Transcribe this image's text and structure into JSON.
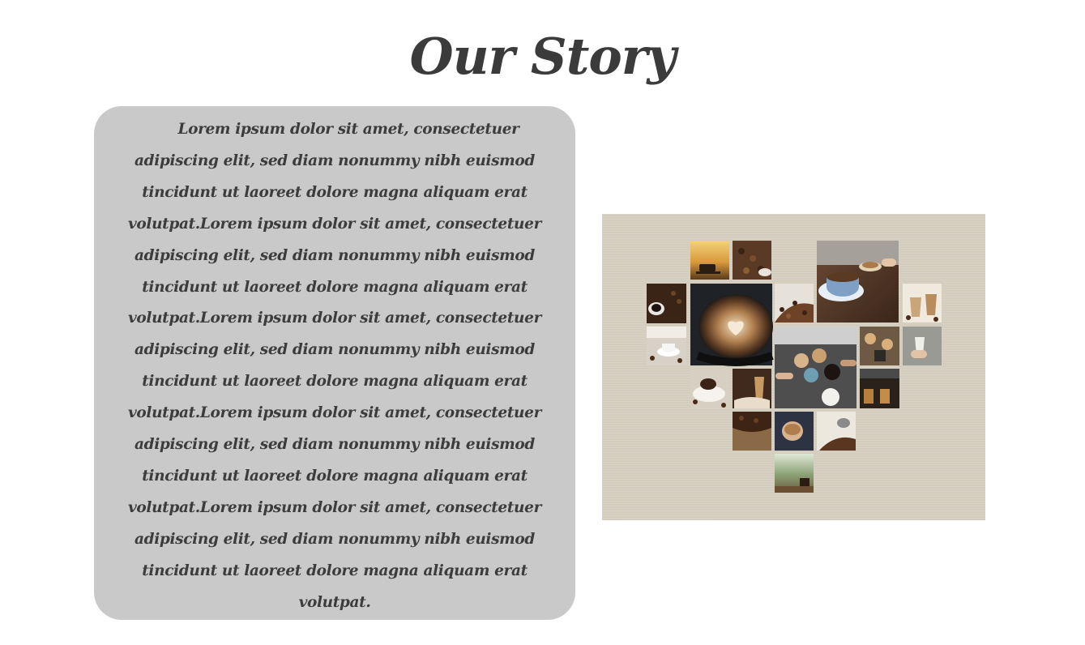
{
  "page": {
    "title": "Our Story"
  },
  "story": {
    "body": "Lorem ipsum dolor sit amet, consectetuer adipiscing elit, sed diam nonummy nibh euismod tincidunt ut laoreet dolore magna aliquam erat volutpat.Lorem ipsum dolor sit amet, consectetuer adipiscing elit, sed diam nonummy nibh euismod tincidunt ut laoreet dolore magna aliquam erat volutpat.Lorem ipsum dolor sit amet, consectetuer adipiscing elit, sed diam nonummy nibh euismod tincidunt ut laoreet dolore magna aliquam erat volutpat.Lorem ipsum dolor sit amet, consectetuer adipiscing elit, sed diam nonummy nibh euismod tincidunt ut laoreet dolore magna aliquam erat volutpat.Lorem ipsum dolor sit amet, consectetuer adipiscing elit, sed diam nonummy nibh euismod tincidunt ut laoreet dolore magna aliquam erat volutpat."
  },
  "colors": {
    "title": "#3b3b3b",
    "card_background": "#c9c9c9",
    "collage_background": "#d6cfc0"
  },
  "collage": {
    "shape": "heart",
    "photos": [
      "sunset-coffee-cup",
      "coffee-beans-scoop",
      "latte-art-cup-on-table",
      "coffee-cup-dark",
      "latte-art-closeup",
      "coffee-beans-pile",
      "takeaway-cups",
      "espresso-cup-with-beans",
      "friends-toasting-coffee",
      "takeaway-cups-street",
      "coffee-in-hand",
      "espresso-cup-with-spoon",
      "iced-coffee-glass",
      "espresso-shots-machine",
      "coffee-beans-sack",
      "hands-holding-latte",
      "coffee-beans-spill",
      "coffee-cup-outdoors"
    ]
  }
}
